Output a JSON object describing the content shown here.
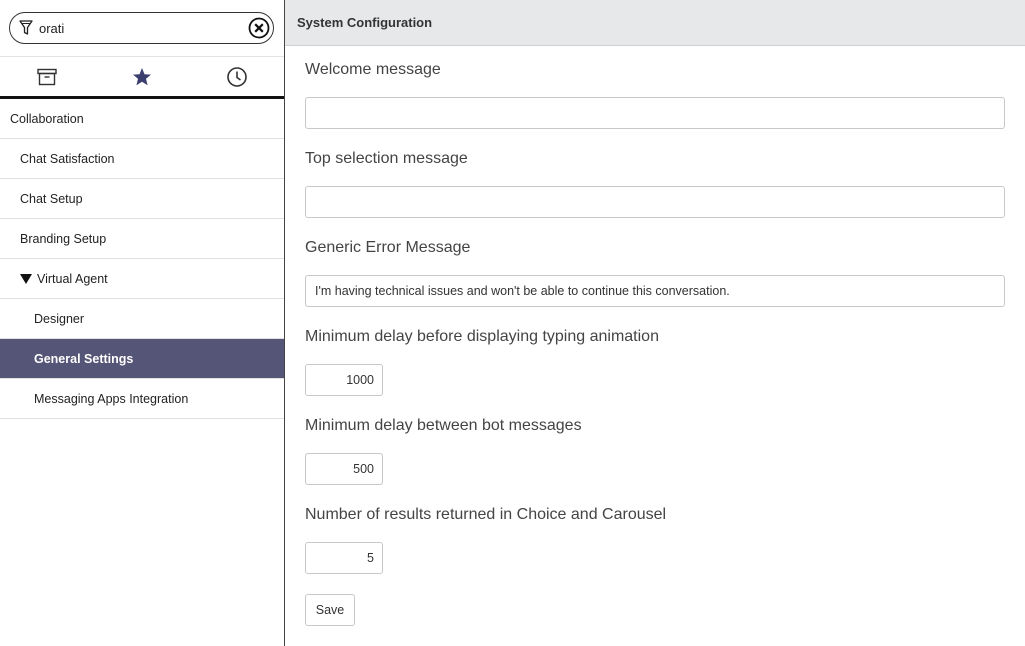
{
  "sidebar": {
    "filter": {
      "value": "orati",
      "placeholder": ""
    },
    "tabs": [
      {
        "name": "all-apps",
        "icon": "archive-icon"
      },
      {
        "name": "favorites",
        "icon": "star-icon"
      },
      {
        "name": "history",
        "icon": "clock-icon"
      }
    ],
    "nav": {
      "collaboration": "Collaboration",
      "chat_satisfaction": "Chat Satisfaction",
      "chat_setup": "Chat Setup",
      "branding_setup": "Branding Setup",
      "virtual_agent": "Virtual Agent",
      "designer": "Designer",
      "general_settings": "General Settings",
      "messaging_apps": "Messaging Apps Integration"
    },
    "active_item": "General Settings",
    "active_color": "#555577"
  },
  "main": {
    "title": "System Configuration",
    "fields": {
      "welcome": {
        "label": "Welcome message",
        "value": ""
      },
      "top_selection": {
        "label": "Top selection message",
        "value": ""
      },
      "generic_error": {
        "label": "Generic Error Message",
        "value": "I'm having technical issues and won't be able to continue this conversation."
      },
      "typing_delay": {
        "label": "Minimum delay before displaying typing animation",
        "value": "1000"
      },
      "bot_delay": {
        "label": "Minimum delay between bot messages",
        "value": "500"
      },
      "results_count": {
        "label": "Number of results returned in Choice and Carousel",
        "value": "5"
      }
    },
    "save_label": "Save"
  }
}
